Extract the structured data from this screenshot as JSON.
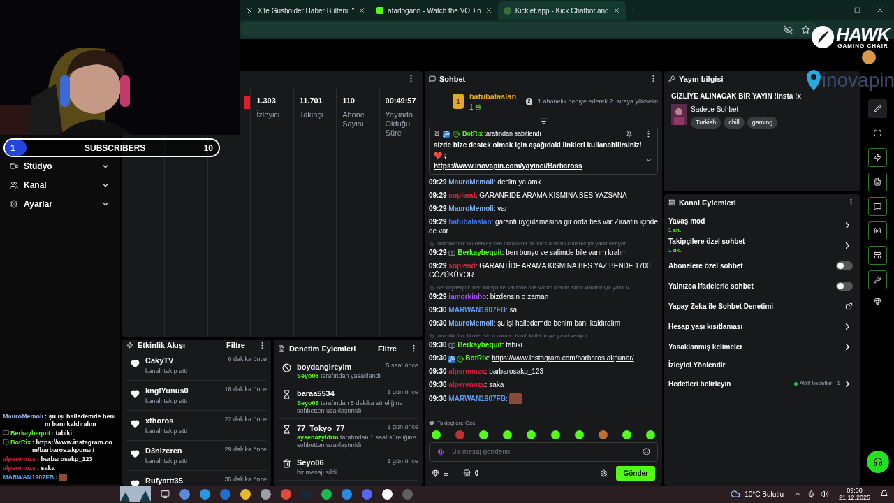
{
  "browser": {
    "tabs": [
      {
        "kind": "x",
        "title": "X'te Gusholder Haber Bülteni: “",
        "selected": false
      },
      {
        "kind": "kick",
        "title": "atadogann - Watch the VOD o",
        "selected": false
      },
      {
        "kind": "kicklet",
        "title": "Kicklet.app - Kick Chatbot and",
        "selected": true
      }
    ]
  },
  "logo": {
    "brand": "HAWK",
    "tagline": "GAMING CHAIR"
  },
  "overlay_logo": "inovapin",
  "subscriber_goal": {
    "count": "1",
    "label": "SUBSCRIBERS",
    "goal": "10",
    "level": 0.1
  },
  "sidebar": {
    "items": [
      {
        "label": "Stüdyo",
        "kind": "studio"
      },
      {
        "label": "Kanal",
        "kind": "channel"
      },
      {
        "label": "Ayarlar",
        "kind": "settings"
      }
    ]
  },
  "stats": {
    "items": [
      {
        "value": "1.303",
        "label": "İzleyici"
      },
      {
        "value": "11.701",
        "label": "Takipçi"
      },
      {
        "value": "110",
        "label": "Abone Sayısı"
      },
      {
        "value": "00:49:57",
        "label": "Yayında Olduğu Süre"
      }
    ]
  },
  "activity": {
    "title": "Etkinlik Akışı",
    "filter": "Filtre",
    "items": [
      {
        "user": "CakyTV",
        "time": "6 dakika önce",
        "action": "kanalı takip etti"
      },
      {
        "user": "knglYunus0",
        "time": "18 dakika önce",
        "action": "kanalı takip etti"
      },
      {
        "user": "xthoros",
        "time": "22 dakika önce",
        "action": "kanalı takip etti"
      },
      {
        "user": "D3nizeren",
        "time": "29 dakika önce",
        "action": "kanalı takip etti"
      },
      {
        "user": "Rufyattt35",
        "time": "35 dakika önce"
      }
    ]
  },
  "moderation": {
    "title": "Denetim Eylemleri",
    "filter": "Filtre",
    "items": [
      {
        "kind": "ban",
        "user": "boydangireyim",
        "time": "5 saat önce",
        "actor": "Seyo06",
        "text": "tarafından yasaklandı"
      },
      {
        "kind": "timeout",
        "user": "baraa5534",
        "time": "1 gün önce",
        "actor": "Seyo06",
        "text": "tarafından 5 dakika süreliğine sohbetten uzaklaştırıldı"
      },
      {
        "kind": "timeout",
        "user": "77_Tokyo_77",
        "time": "1 gün önce",
        "actor": "aysenazyldrm",
        "text": "tarafından 1 saat süreliğine sohbetten uzaklaştırıldı"
      },
      {
        "kind": "delete",
        "user": "Seyo06",
        "time": "1 gün önce",
        "text": "bir mesajı sildi"
      }
    ]
  },
  "chat": {
    "title": "Sohbet",
    "top_gifter": {
      "rank": "1",
      "user": "batubalaslan",
      "gifts": "1"
    },
    "next_rank": {
      "rank": "2",
      "text": "1 abonelik hediye ederek 2. sıraya yükselin"
    },
    "pinned": {
      "by": "BotRix",
      "label": "tarafından sabitlendi",
      "text": "sizde bize destek olmak için aşağıdaki linkleri kullanabilirsiniz! ❤️ ;",
      "link": "https://www.inovapin.com/yayinci/Barbaross"
    },
    "messages": [
      {
        "kind": "plain",
        "time": "09:29",
        "user": "MauroMemoli",
        "color": "#7fb0f5",
        "text": ": dedim ya amk"
      },
      {
        "kind": "plain",
        "time": "09:29",
        "user": "soplend",
        "color": "#e0243c",
        "text": ": GARANRİDE ARAMA KISMINA BES YAZSANA"
      },
      {
        "kind": "plain",
        "time": "09:29",
        "user": "MauroMemoli",
        "color": "#7fb0f5",
        "text": ": var"
      },
      {
        "kind": "plain",
        "time": "09:29",
        "user": "batubalaslan",
        "color": "#3b74f0",
        "text": ": garanti uygulamasına gir orda bes var Ziraatin içinde de var"
      },
      {
        "kind": "book",
        "time": "09:29",
        "user": "Berkaybequit",
        "color": "#53fc18",
        "text": ": ben bunyo ve salimde bile varım kralım",
        "reply": "iamorkinho: oo berkay sen buralarda da varsın isimli kullanıcıya yanıt veriyor"
      },
      {
        "kind": "plain",
        "time": "09:29",
        "user": "soplend",
        "color": "#e0243c",
        "text": ": GARANTİDE ARAMA KISMINA BES YAZ BENDE 1700 GÖZÜKÜYOR"
      },
      {
        "kind": "plain",
        "time": "09:29",
        "user": "iamorkinho",
        "color": "#a855f7",
        "text": ": bizdensin o zaman",
        "reply": "Berkaybequit: ben bunyo ve salimde bile varım kralım isimli kullanıcıya yanıt v..."
      },
      {
        "kind": "plain",
        "time": "09:30",
        "user": "MARWAN1907FB",
        "color": "#5b9cf5",
        "text": ": sa"
      },
      {
        "kind": "plain",
        "time": "09:30",
        "user": "MauroMemoli",
        "color": "#7fb0f5",
        "text": ": şu işi halledemde benim banı kaldıralım"
      },
      {
        "kind": "book",
        "time": "09:30",
        "user": "Berkaybequit",
        "color": "#53fc18",
        "text": ": tabiki",
        "reply": "iamorkinho: bizdensin o zaman isimli kullanıcıya yanıt veriyor"
      },
      {
        "kind": "bot",
        "time": "09:30",
        "user": "BotRix",
        "color": "#53fc18",
        "text": ":",
        "link": "https://www.instagram.com/barbaros.akpunar/"
      },
      {
        "kind": "plain",
        "time": "09:30",
        "user": "alperenozs",
        "color": "#d01f3c",
        "text": ": barbarosakp_123"
      },
      {
        "kind": "plain",
        "time": "09:30",
        "user": "alperenozs",
        "color": "#d01f3c",
        "text": ": saka"
      },
      {
        "kind": "emote",
        "time": "09:30",
        "user": "MARWAN1907FB",
        "color": "#5b9cf5",
        "text": ":"
      }
    ],
    "emote_section": "Takipçilere Özel",
    "input": {
      "placeholder": "Bir mesaj gönderin"
    },
    "points": "∞",
    "store_count": "0",
    "send": "Gönder"
  },
  "stream_info": {
    "title": "Yayın bilgisi",
    "stream_title": "GİZLİYE ALINACAK BİR YAYIN !insta !x",
    "category": "Sadece Sohbet",
    "tags": [
      "Turkish",
      "chill",
      "gaming"
    ]
  },
  "channel_actions": {
    "title": "Kanal Eylemleri",
    "items": [
      {
        "kind": "nav",
        "label": "Yavaş mod",
        "value": "1 sn."
      },
      {
        "kind": "nav",
        "label": "Takipçilere özel sohbet",
        "value": "1 dk."
      },
      {
        "kind": "toggle",
        "label": "Abonelere özel sohbet",
        "on": false
      },
      {
        "kind": "toggle",
        "label": "Yalnızca ifadelerle sohbet",
        "on": false
      },
      {
        "kind": "external",
        "label": "Yapay Zeka ile Sohbet Denetimi"
      },
      {
        "kind": "nav",
        "label": "Hesap yaşı kısıtlaması"
      },
      {
        "kind": "nav",
        "label": "Yasaklanmış kelimeler"
      },
      {
        "kind": "plain",
        "label": "İzleyici Yönlendir"
      },
      {
        "kind": "goal",
        "label": "Hedefleri belirleyin",
        "status": "Aktif hedefler - 1",
        "color": "#22c55e"
      }
    ]
  },
  "stream_chat_overlay": [
    {
      "kind": "plain",
      "user": "MauroMemoli",
      "color": "#9db8e8",
      "text": ": şu işi halledemde benim banı kaldıralım"
    },
    {
      "kind": "book",
      "user": "Berkaybequit",
      "color": "#53fc18",
      "text": ": tabiki"
    },
    {
      "kind": "bot",
      "user": "BotRix",
      "color": "#53fc18",
      "text": ": https://www.instagram.com/barbaros.akpunar/"
    },
    {
      "kind": "plain",
      "user": "alperenozs",
      "color": "#d01f3c",
      "text": ": barbarosakp_123"
    },
    {
      "kind": "plain",
      "user": "alperenozs",
      "color": "#d01f3c",
      "text": ": saka"
    },
    {
      "kind": "emote",
      "user": "MARWAN1907FB",
      "color": "#5b9cf5",
      "text": ":"
    }
  ],
  "taskbar": {
    "weather": "10°C Bulutlu",
    "time": "09:30",
    "date": "21.12.2025"
  }
}
